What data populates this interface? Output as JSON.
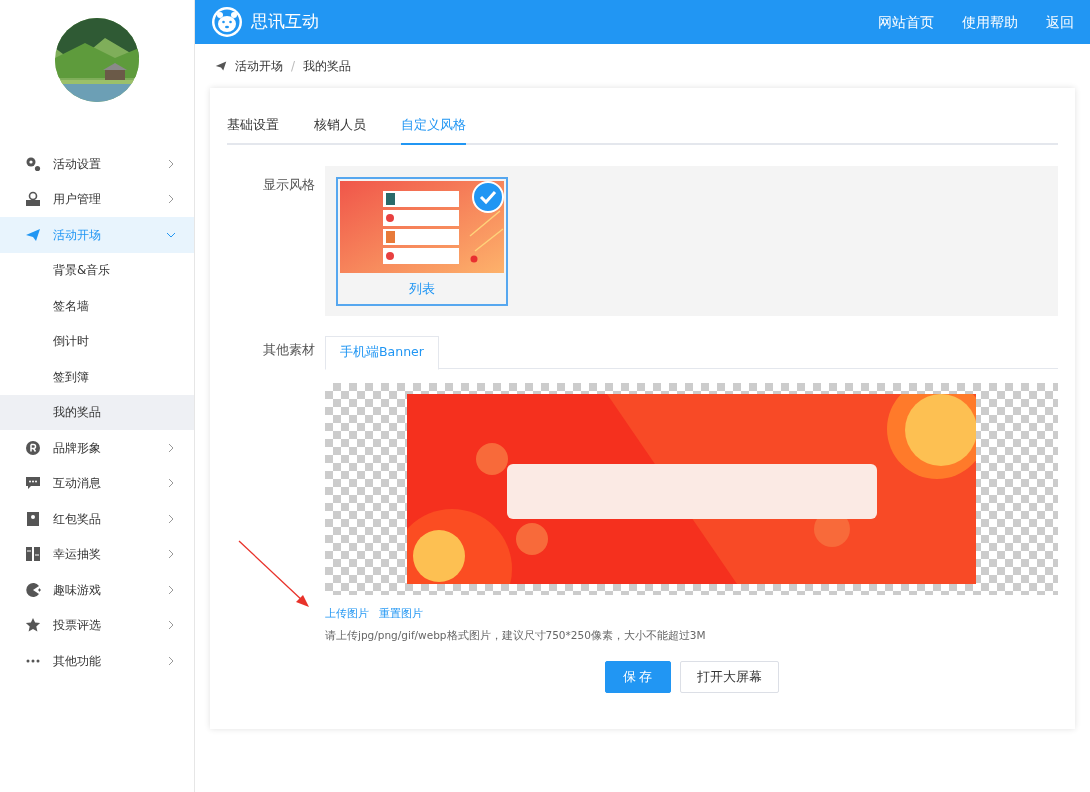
{
  "header": {
    "brand": "思讯互动",
    "links": [
      "网站首页",
      "使用帮助",
      "返回"
    ]
  },
  "breadcrumb": {
    "items": [
      "活动开场",
      "我的奖品"
    ],
    "separator": "/"
  },
  "sidebar": {
    "items": [
      {
        "label": "活动设置",
        "expanded": false,
        "selected": false
      },
      {
        "label": "用户管理",
        "expanded": false,
        "selected": false
      },
      {
        "label": "活动开场",
        "expanded": true,
        "selected": true,
        "children": [
          {
            "label": "背景&音乐",
            "selected": false
          },
          {
            "label": "签名墙",
            "selected": false
          },
          {
            "label": "倒计时",
            "selected": false
          },
          {
            "label": "签到簿",
            "selected": false
          },
          {
            "label": "我的奖品",
            "selected": true
          }
        ]
      },
      {
        "label": "品牌形象",
        "expanded": false,
        "selected": false
      },
      {
        "label": "互动消息",
        "expanded": false,
        "selected": false
      },
      {
        "label": "红包奖品",
        "expanded": false,
        "selected": false
      },
      {
        "label": "幸运抽奖",
        "expanded": false,
        "selected": false
      },
      {
        "label": "趣味游戏",
        "expanded": false,
        "selected": false
      },
      {
        "label": "投票评选",
        "expanded": false,
        "selected": false
      },
      {
        "label": "其他功能",
        "expanded": false,
        "selected": false
      }
    ]
  },
  "tabs": [
    {
      "label": "基础设置",
      "selected": false
    },
    {
      "label": "核销人员",
      "selected": false
    },
    {
      "label": "自定义风格",
      "selected": true
    }
  ],
  "display_style": {
    "label": "显示风格",
    "options": [
      {
        "label": "列表",
        "selected": true
      }
    ]
  },
  "other_materials": {
    "label": "其他素材",
    "tabs": [
      {
        "label": "手机端Banner",
        "selected": true
      }
    ],
    "actions": [
      "上传图片",
      "重置图片"
    ],
    "hint": "请上传jpg/png/gif/webp格式图片，建议尺寸750*250像素，大小不能超过3M"
  },
  "buttons": [
    {
      "label": "保 存",
      "kind": "primary"
    },
    {
      "label": "打开大屏幕",
      "kind": "secondary"
    }
  ]
}
